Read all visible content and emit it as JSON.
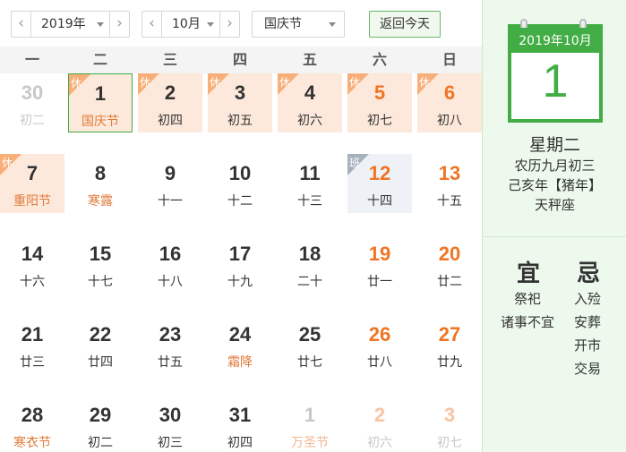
{
  "toolbar": {
    "year": "2019年",
    "month": "10月",
    "holiday": "国庆节",
    "today_label": "返回今天"
  },
  "weekdays": [
    "一",
    "二",
    "三",
    "四",
    "五",
    "六",
    "日"
  ],
  "tags": {
    "rest": "休",
    "work": "班"
  },
  "weeks": [
    [
      {
        "day": "30",
        "sub": "初二",
        "other": true
      },
      {
        "day": "1",
        "sub": "国庆节",
        "fest": true,
        "rest": true,
        "selected": true
      },
      {
        "day": "2",
        "sub": "初四",
        "rest": true
      },
      {
        "day": "3",
        "sub": "初五",
        "rest": true
      },
      {
        "day": "4",
        "sub": "初六",
        "rest": true
      },
      {
        "day": "5",
        "sub": "初七",
        "rest": true,
        "weekend": true
      },
      {
        "day": "6",
        "sub": "初八",
        "rest": true,
        "weekend": true
      }
    ],
    [
      {
        "day": "7",
        "sub": "重阳节",
        "fest": true,
        "rest": true
      },
      {
        "day": "8",
        "sub": "寒露",
        "fest": true
      },
      {
        "day": "9",
        "sub": "十一"
      },
      {
        "day": "10",
        "sub": "十二"
      },
      {
        "day": "11",
        "sub": "十三"
      },
      {
        "day": "12",
        "sub": "十四",
        "work": true,
        "weekend": true
      },
      {
        "day": "13",
        "sub": "十五",
        "weekend": true
      }
    ],
    [
      {
        "day": "14",
        "sub": "十六"
      },
      {
        "day": "15",
        "sub": "十七"
      },
      {
        "day": "16",
        "sub": "十八"
      },
      {
        "day": "17",
        "sub": "十九"
      },
      {
        "day": "18",
        "sub": "二十"
      },
      {
        "day": "19",
        "sub": "廿一",
        "weekend": true
      },
      {
        "day": "20",
        "sub": "廿二",
        "weekend": true
      }
    ],
    [
      {
        "day": "21",
        "sub": "廿三"
      },
      {
        "day": "22",
        "sub": "廿四"
      },
      {
        "day": "23",
        "sub": "廿五"
      },
      {
        "day": "24",
        "sub": "霜降",
        "fest": true
      },
      {
        "day": "25",
        "sub": "廿七"
      },
      {
        "day": "26",
        "sub": "廿八",
        "weekend": true
      },
      {
        "day": "27",
        "sub": "廿九",
        "weekend": true
      }
    ],
    [
      {
        "day": "28",
        "sub": "寒衣节",
        "fest": true
      },
      {
        "day": "29",
        "sub": "初二"
      },
      {
        "day": "30",
        "sub": "初三"
      },
      {
        "day": "31",
        "sub": "初四"
      },
      {
        "day": "1",
        "sub": "万圣节",
        "fest": true,
        "other": true
      },
      {
        "day": "2",
        "sub": "初六",
        "other": true,
        "weekend": true
      },
      {
        "day": "3",
        "sub": "初七",
        "other": true,
        "weekend": true
      }
    ]
  ],
  "panel": {
    "card_month": "2019年10月",
    "card_day": "1",
    "weekday": "星期二",
    "lunar": "农历九月初三",
    "ganzhi": "己亥年【猪年】",
    "constellation": "天秤座",
    "yi_title": "宜",
    "ji_title": "忌",
    "yi_items": [
      "祭祀",
      "诸事不宜"
    ],
    "ji_items": [
      "入殓",
      "安葬",
      "开市",
      "交易"
    ]
  },
  "colors": {
    "accent_green": "#42ad44",
    "weekend_orange": "#f07424",
    "holiday_bg": "#fde9db",
    "panel_bg": "#edf9ec"
  }
}
